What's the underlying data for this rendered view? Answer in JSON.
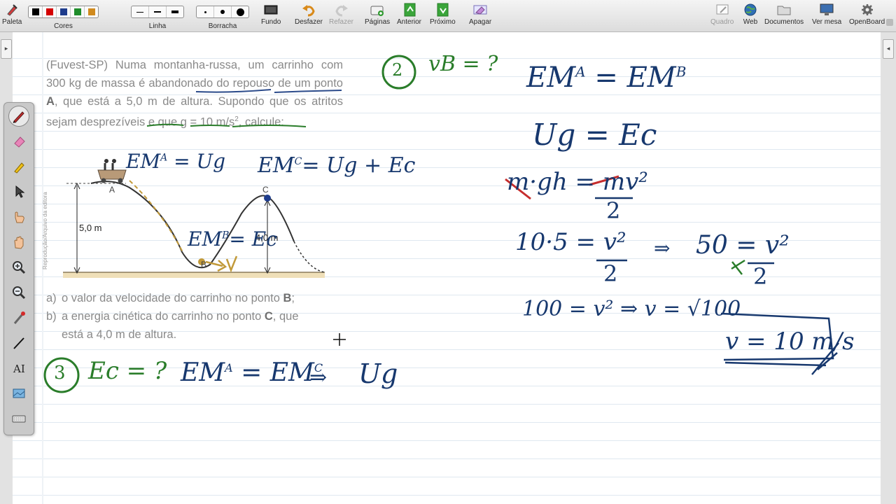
{
  "toolbar": {
    "palette": "Paleta",
    "colors": "Cores",
    "color_swatches": [
      "#000000",
      "#d40000",
      "#1e3c8c",
      "#1e8c2a",
      "#d08a1e"
    ],
    "line": "Linha",
    "eraser": "Borracha",
    "background": "Fundo",
    "undo": "Desfazer",
    "redo": "Refazer",
    "pages": "Páginas",
    "previous": "Anterior",
    "next": "Próximo",
    "erase": "Apagar",
    "board": "Quadro",
    "web": "Web",
    "documents": "Documentos",
    "desktop": "Ver mesa",
    "app": "OpenBoard"
  },
  "problem": {
    "source": "(Fuvest-SP)",
    "part1": " Numa montanha-russa, um carrinho com 300 kg de massa é ",
    "w_abandonado": "abandonado",
    "part2": " ",
    "w_repouso": "do repouso",
    "part3": " de um ponto ",
    "point_a": "A",
    "part4": ", que está a 5,0 m de altura. Supondo que os ",
    "w_atritos": "atritos",
    "part5": " ",
    "w_sejam": "sejam",
    "part6": " ",
    "w_desprez": "desprezíveis",
    "part7": " e que g = 10 m/s",
    "sup2": "2",
    "part8": ", calcule:",
    "item_a_mark": "a)",
    "item_a_text": "o valor da velocidade do carrinho no ponto ",
    "item_a_point": "B",
    "item_a_end": ";",
    "item_b_mark": "b)",
    "item_b_text": "a energia cinética do carrinho no ponto ",
    "item_b_point": "C",
    "item_b_end": ", que",
    "item_b_line2": "está a 4,0 m de altura."
  },
  "figure": {
    "label_a": "A",
    "label_b": "B",
    "label_c": "C",
    "height_a": "5,0 m",
    "height_c": "4,0 m",
    "credit": "Reprodução/Arquivo da editora"
  },
  "notes": {
    "fig_ea": "EM",
    "fig_ea_sup": "A",
    "fig_ea_rhs": " = Ug",
    "fig_ec": "EM",
    "fig_ec_sup": "C",
    "fig_ec_rhs": "= Ug + Ec",
    "fig_eb": "EM",
    "fig_eb_sup": "B",
    "fig_eb_rhs": "= Ec",
    "q2_num": "2",
    "q2_text": "vB = ?",
    "q3_num": "3",
    "q3_text": "Ec = ?",
    "q3_lhs": "EM",
    "q3_lhs_sup": "A",
    "q3_eq": " = ",
    "q3_rhs": "EM",
    "q3_rhs_sup": "C",
    "q3_arrow": "⇒",
    "q3_ug": "Ug",
    "r1_lhs": "EM",
    "r1_lhs_sup": "A",
    "r1_eq": " = ",
    "r1_rhs": "EM",
    "r1_rhs_sup": "B",
    "r2": "Ug = Ec",
    "r3_m": "m",
    "r3_mid": "·gh = ",
    "r3_num": "mv²",
    "r3_den": "2",
    "r4_lhs": "10·5 = ",
    "r4_num": "v²",
    "r4_den": "2",
    "r4_arrow": "⇒",
    "r4_50": "50 = ",
    "r4b_num": "v²",
    "r4b_den": "2",
    "r5": "100 = v²  ⇒  v = √100",
    "answer": "v = 10 m/s"
  }
}
